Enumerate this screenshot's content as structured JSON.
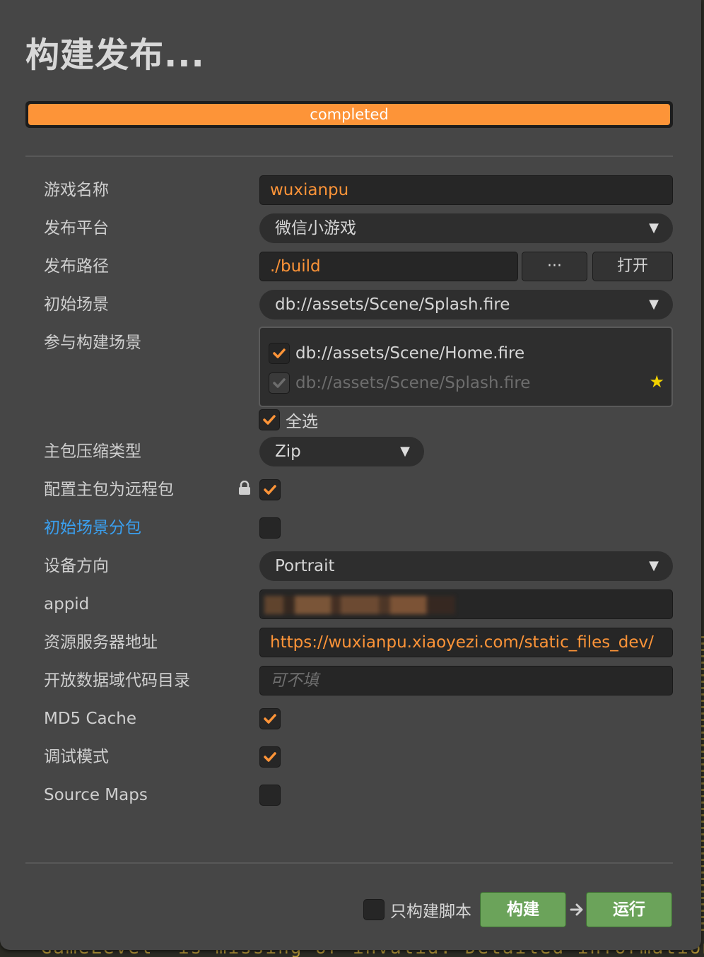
{
  "window": {
    "title": "构建发布..."
  },
  "progress": {
    "label": "completed",
    "value": 1.0
  },
  "fields": {
    "game_name": {
      "label": "游戏名称",
      "value": "wuxianpu"
    },
    "platform": {
      "label": "发布平台",
      "value": "微信小游戏"
    },
    "build_path": {
      "label": "发布路径",
      "value": "./build",
      "browse_label": "···",
      "open_label": "打开"
    },
    "start_scene": {
      "label": "初始场景",
      "value": "db://assets/Scene/Splash.fire"
    },
    "scenes": {
      "label": "参与构建场景",
      "items": [
        {
          "name": "db://assets/Scene/Home.fire",
          "checked": true
        },
        {
          "name": "db://assets/Scene/Splash.fire",
          "checked": true,
          "disabled": true
        }
      ],
      "select_all_label": "全选"
    },
    "compress_type": {
      "label": "主包压缩类型",
      "value": "Zip"
    },
    "remote_main": {
      "label": "配置主包为远程包",
      "checked": true
    },
    "start_scene_subpackage": {
      "label": "初始场景分包",
      "checked": false
    },
    "orientation": {
      "label": "设备方向",
      "value": "Portrait"
    },
    "appid": {
      "label": "appid"
    },
    "remote_server": {
      "label": "资源服务器地址",
      "value": "https://wuxianpu.xiaoyezi.com/static_files_dev/"
    },
    "open_data": {
      "label": "开放数据域代码目录",
      "placeholder": "可不填"
    },
    "md5_cache": {
      "label": "MD5 Cache",
      "checked": true
    },
    "debug": {
      "label": "调试模式",
      "checked": true
    },
    "source_maps": {
      "label": "Source Maps",
      "checked": false
    }
  },
  "footer": {
    "build_script_only_label": "只构建脚本",
    "build_label": "构建",
    "run_label": "运行"
  },
  "console": {
    "text": "'GameLevel' is missing or invalid. Detailed information:"
  },
  "colors": {
    "accent": "#fd9438",
    "link": "#3aa0f0",
    "green": "#6ba35a",
    "panel": "#464646"
  }
}
